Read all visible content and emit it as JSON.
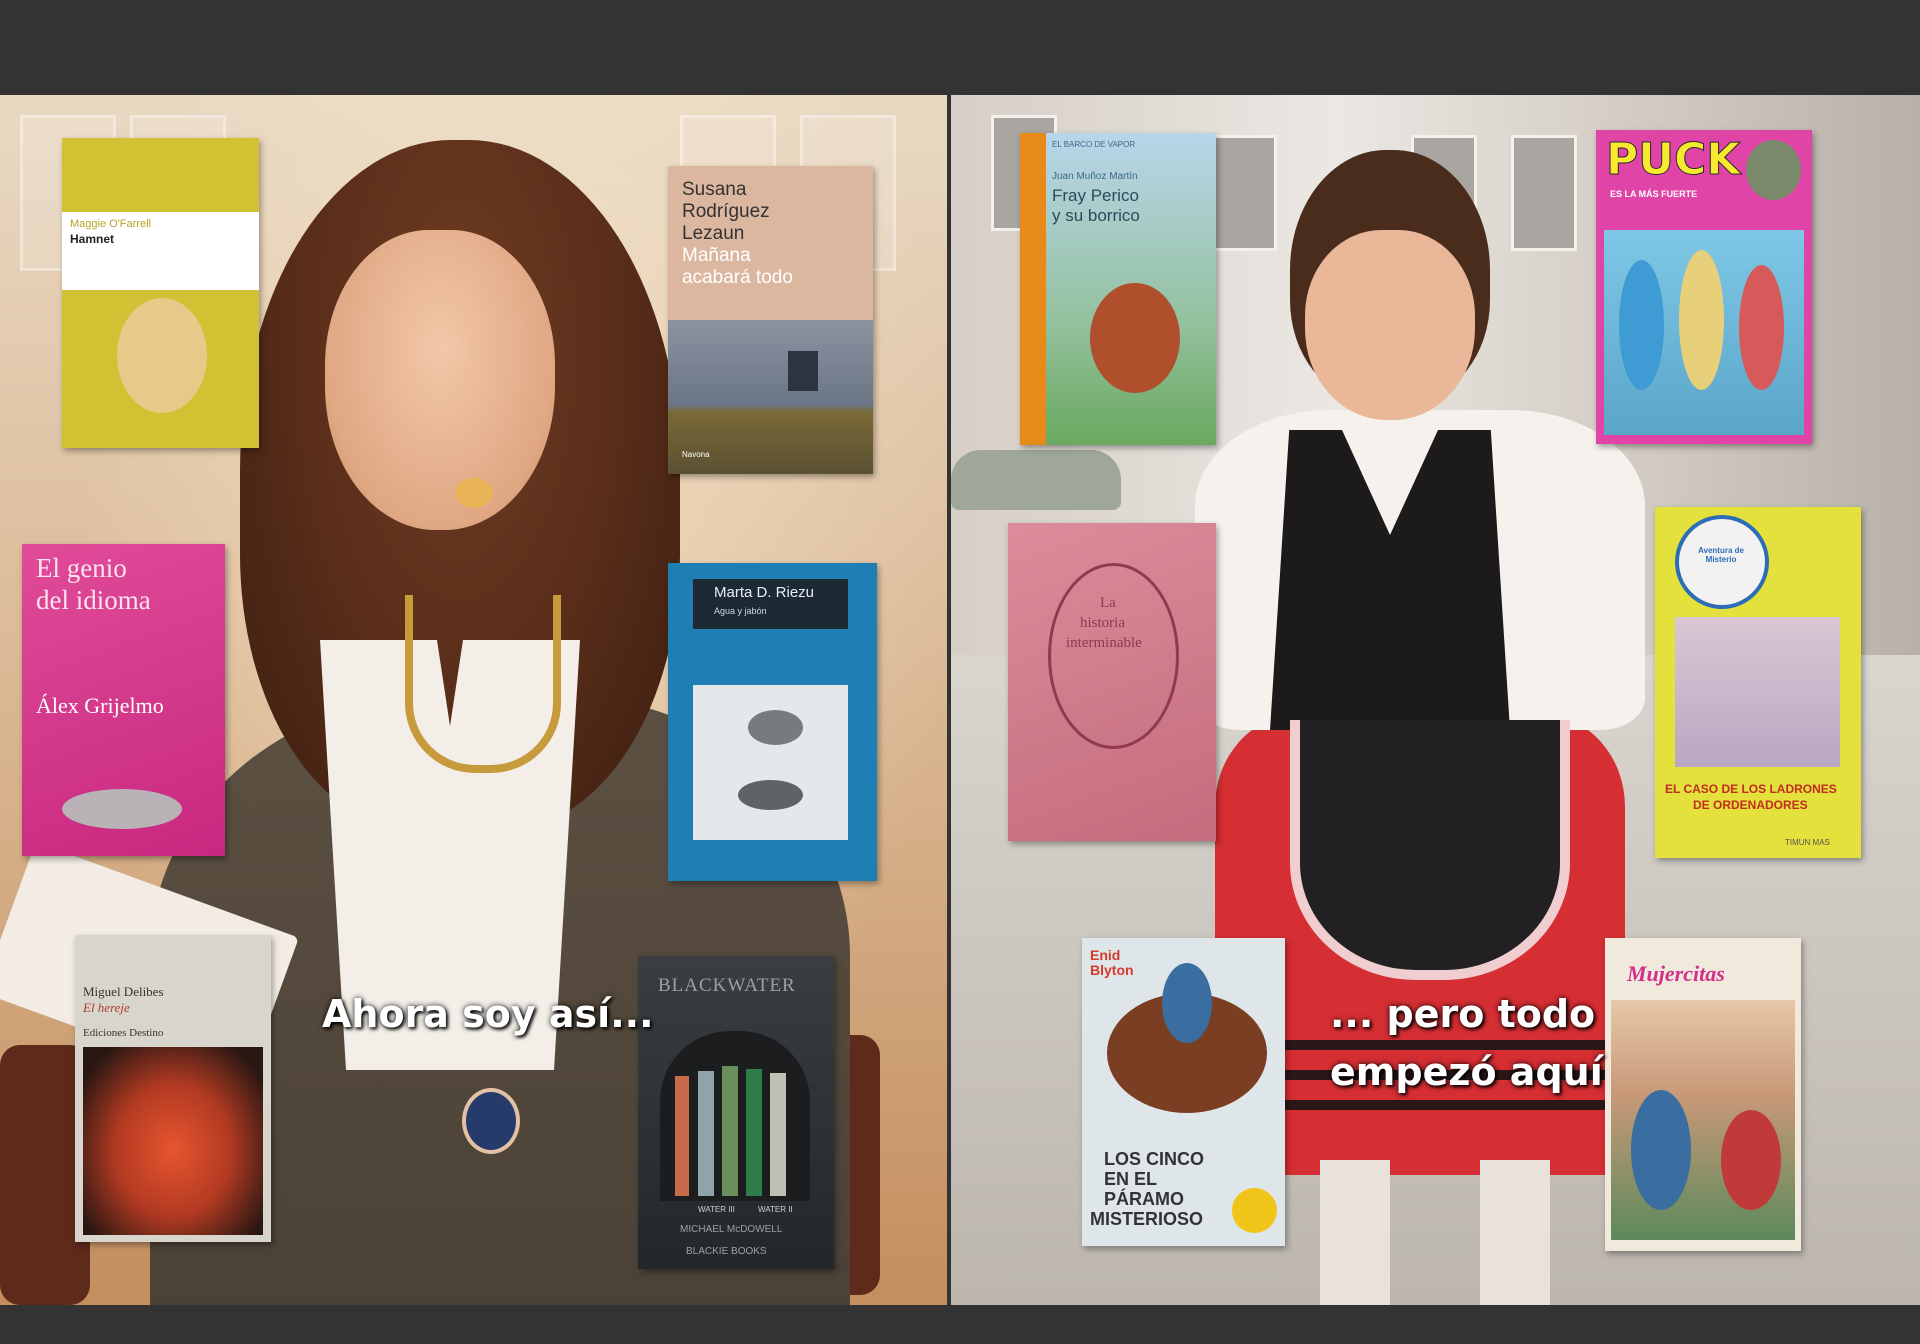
{
  "captions": {
    "left": "Ahora soy así...",
    "right_line1": "... pero todo",
    "right_line2": "empezó aquí"
  },
  "books_left": {
    "hamnet": {
      "author": "Maggie O'Farrell",
      "title": "Hamnet",
      "colors": {
        "cover": "#d2c133",
        "band": "#ffffff"
      }
    },
    "manana": {
      "author_line1": "Susana",
      "author_line2": "Rodríguez",
      "author_line3": "Lezaun",
      "title_line1": "Mañana",
      "title_line2": "acabará todo",
      "publisher": "Navona",
      "colors": {
        "cover": "#dcb79f",
        "art": "#6b7686"
      }
    },
    "genio": {
      "title_line1": "El genio",
      "title_line2": "del idioma",
      "author": "Álex Grijelmo",
      "colors": {
        "cover": "#d2338c"
      }
    },
    "agua": {
      "author": "Marta D. Riezu",
      "title": "Agua y jabón",
      "colors": {
        "cover": "#1f7fb5"
      }
    },
    "hereje": {
      "author": "Miguel Delibes",
      "title": "El hereje",
      "publisher": "Ediciones Destino",
      "colors": {
        "cover": "#d8d6cc",
        "art": "#c84a2a"
      }
    },
    "blackwater": {
      "title": "BLACKWATER",
      "spine1": "WATER III",
      "spine2": "WATER II",
      "author": "MICHAEL McDOWELL",
      "publisher": "BLACKIE BOOKS",
      "colors": {
        "cover": "#2f3335"
      }
    }
  },
  "books_right": {
    "perico": {
      "header": "EL BARCO DE VAPOR",
      "author": "Juan Muñoz Martín",
      "title_line1": "Fray Perico",
      "title_line2": "y su borrico",
      "colors": {
        "cover": "#9dc0d8",
        "spine": "#e88a1a"
      }
    },
    "puck": {
      "title": "PUCK",
      "subtitle": "ES LA MÁS FUERTE",
      "colors": {
        "cover": "#e044a6",
        "art": "#5aa6c9"
      }
    },
    "historia": {
      "title_line1": "La",
      "title_line2": "historia",
      "title_line3": "interminable",
      "colors": {
        "cover": "#d07c8d"
      }
    },
    "misterio": {
      "badge": "Aventura de Misterio",
      "title_line1": "EL CASO DE LOS LADRONES",
      "title_line2": "DE ORDENADORES",
      "publisher": "TIMUN MAS",
      "colors": {
        "cover": "#e4e03c",
        "title": "#c22d1f"
      }
    },
    "cinco": {
      "author": "Enid Blyton",
      "title_line1": "LOS CINCO",
      "title_line2": "EN EL",
      "title_line3": "PÁRAMO",
      "title_line4": "MISTERIOSO",
      "colors": {
        "cover": "#dfe6ea",
        "horse": "#7a3e22"
      }
    },
    "mujercitas": {
      "title": "Mujercitas",
      "colors": {
        "cover": "#f0e9dc",
        "title": "#d22f8a"
      }
    }
  }
}
